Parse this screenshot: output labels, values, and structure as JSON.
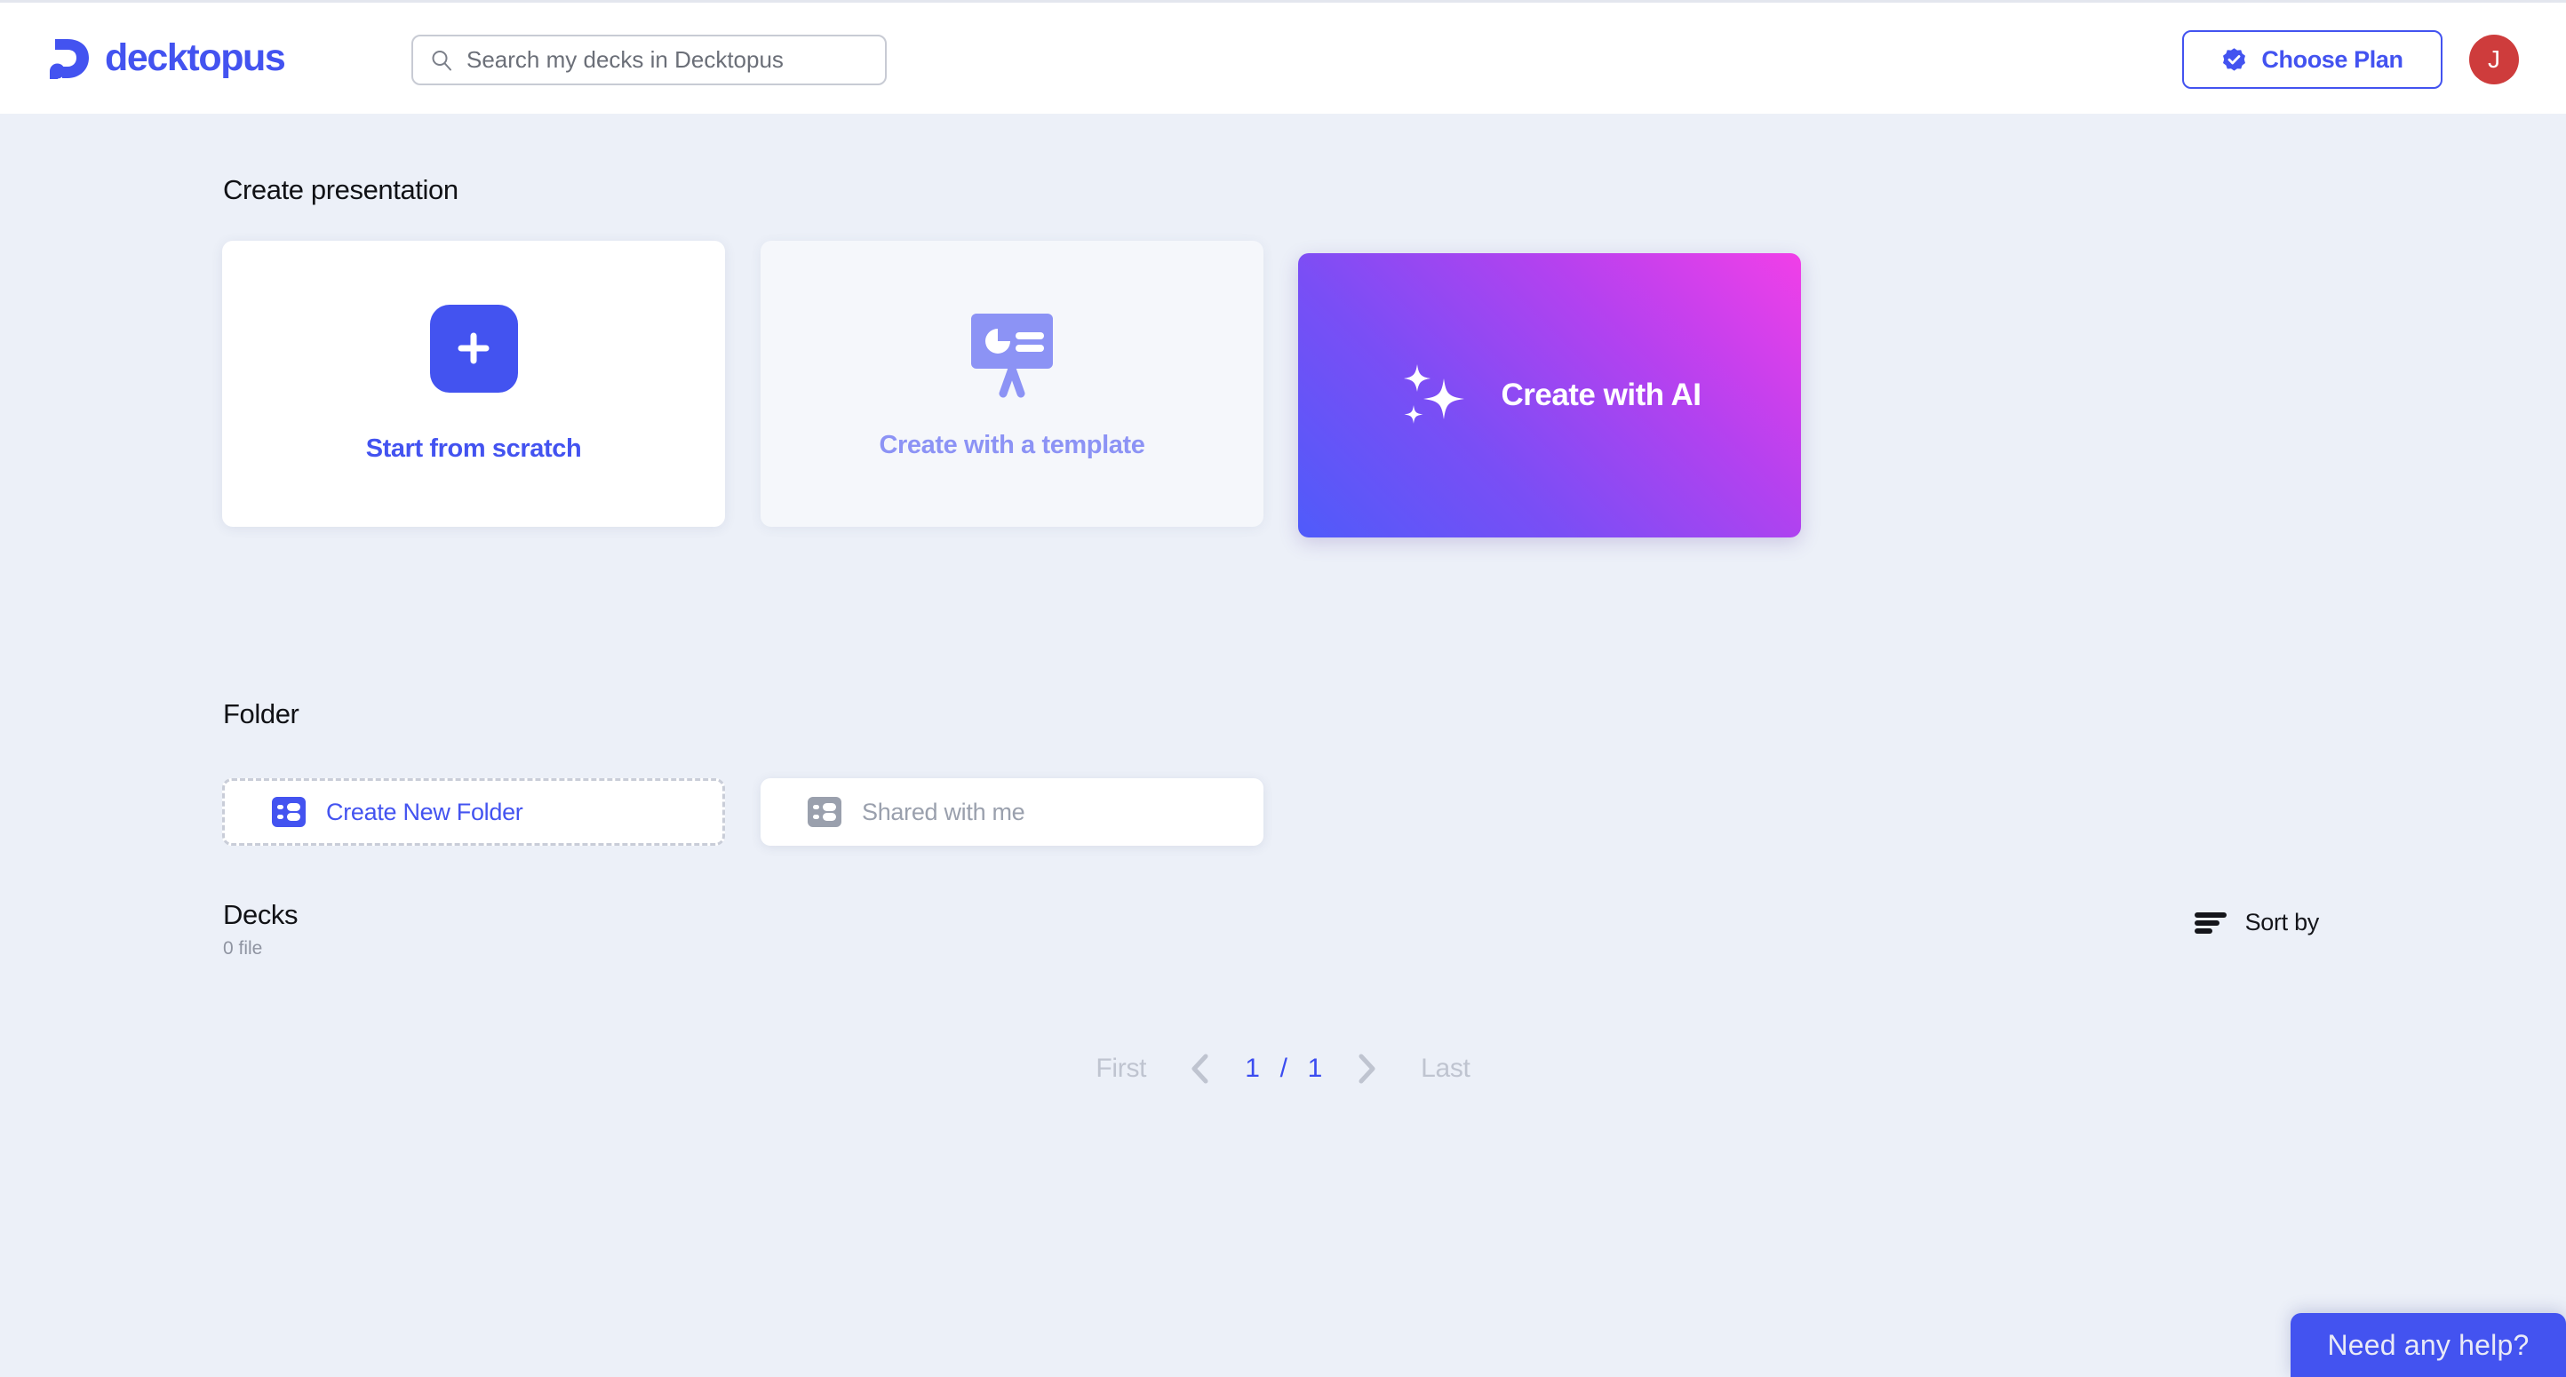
{
  "header": {
    "brand_name": "decktopus",
    "brand_mark_icon": "decktopus-logo-icon",
    "search": {
      "placeholder": "Search my decks in Decktopus",
      "value": "",
      "icon": "search-icon"
    },
    "plan_button": {
      "label": "Choose Plan",
      "icon": "verified-badge-icon"
    },
    "avatar": {
      "initial": "J",
      "color": "#ce3c3c"
    }
  },
  "main": {
    "create_section": {
      "title": "Create presentation",
      "cards": [
        {
          "label": "Start from scratch",
          "icon": "plus-icon",
          "style": "white"
        },
        {
          "label": "Create with a template",
          "icon": "presentation-board-icon",
          "style": "muted"
        },
        {
          "label": "Create with AI",
          "icon": "sparkles-icon",
          "style": "gradient"
        }
      ]
    },
    "folder_section": {
      "title": "Folder",
      "items": [
        {
          "label": "Create New Folder",
          "icon": "layout-list-icon",
          "style": "dashed"
        },
        {
          "label": "Shared with me",
          "icon": "layout-list-icon",
          "style": "solid"
        }
      ]
    },
    "decks_section": {
      "title": "Decks",
      "count_text": "0 file",
      "sort": {
        "label": "Sort by",
        "icon": "sort-lines-icon"
      }
    },
    "pagination": {
      "first_label": "First",
      "prev_icon": "chevron-left-icon",
      "current_page": "1",
      "separator": "/",
      "total_pages": "1",
      "next_icon": "chevron-right-icon",
      "last_label": "Last"
    }
  },
  "chat_widget": {
    "label": "Need any help?"
  },
  "colors": {
    "brand_blue": "#4353f0",
    "page_background": "#ecf0f8",
    "avatar_red": "#ce3c3c",
    "muted_text": "#9aa0ad",
    "ai_gradient_start": "#4f5bfa",
    "ai_gradient_end": "#f13fe8"
  }
}
